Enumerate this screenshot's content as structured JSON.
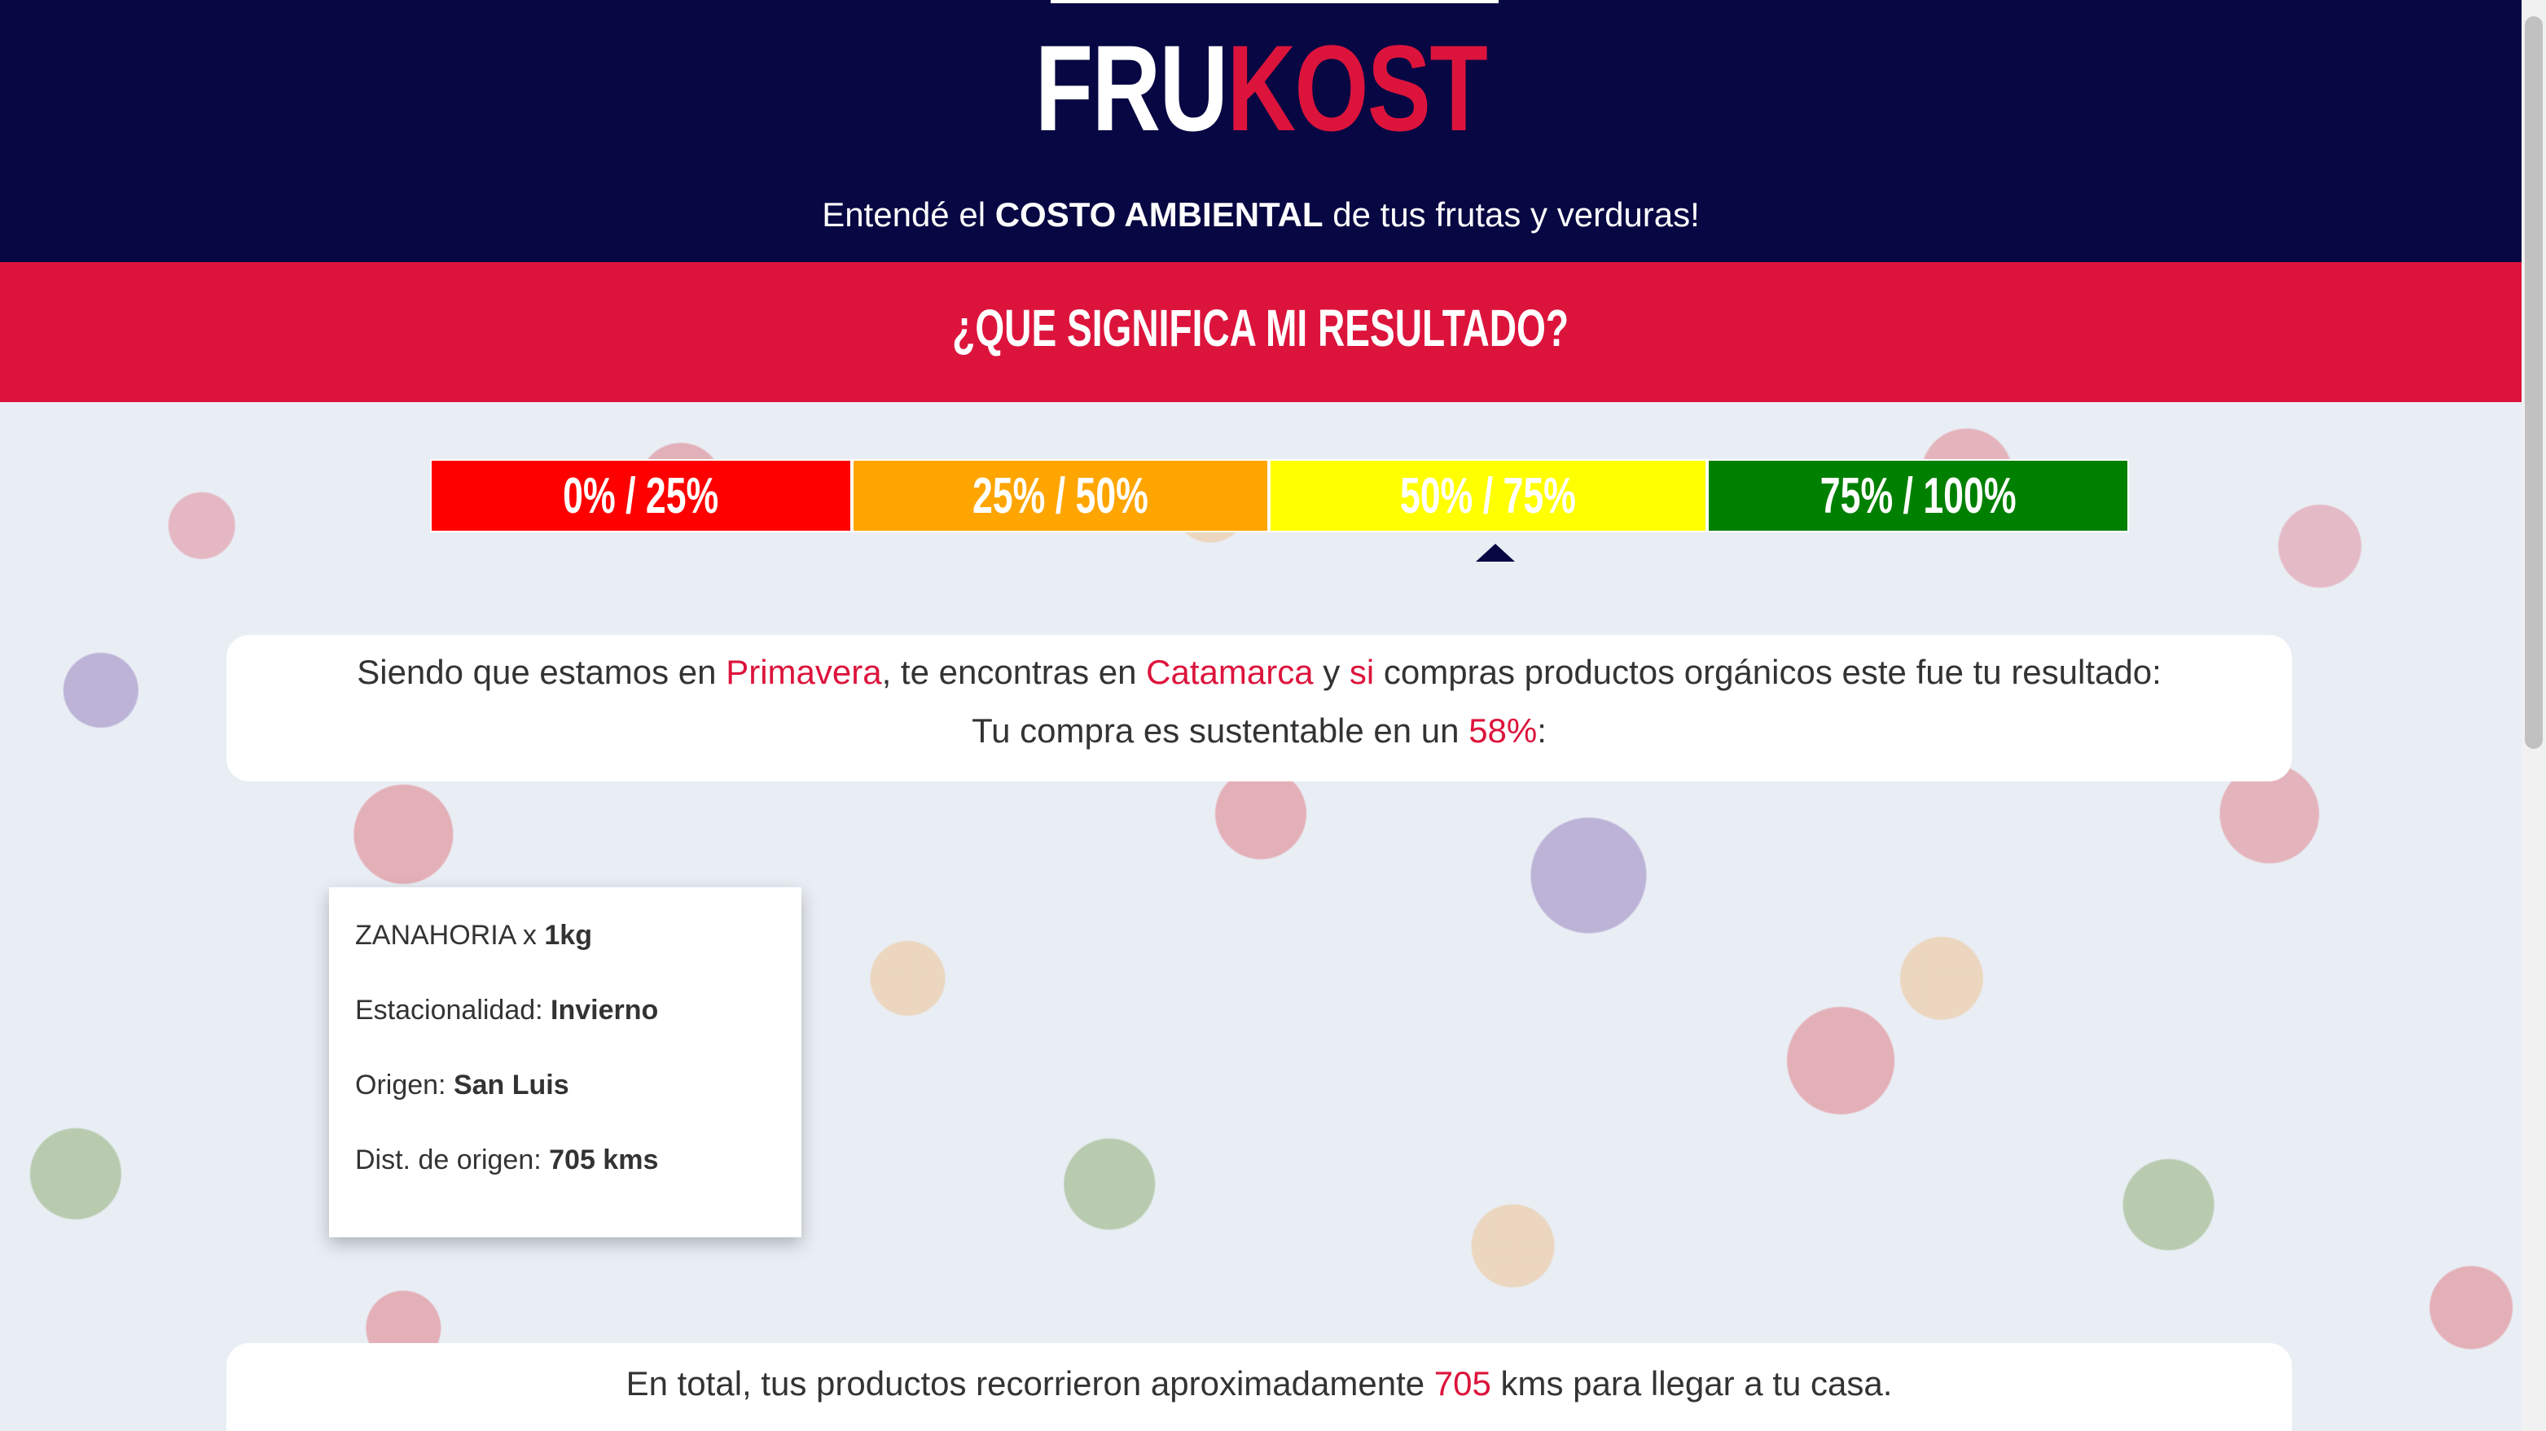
{
  "header": {
    "logo_part1": "FRU",
    "logo_part2": "KOST",
    "tagline_pre": "Entendé el ",
    "tagline_bold": "COSTO AMBIENTAL",
    "tagline_post": " de tus frutas y verduras!"
  },
  "banner": {
    "title": "¿QUE SIGNIFICA MI RESULTADO?"
  },
  "scale": {
    "segments": [
      {
        "label": "0% / 25%",
        "color": "#ff0000"
      },
      {
        "label": "25% / 50%",
        "color": "#ffa500"
      },
      {
        "label": "50% / 75%",
        "color": "#ffff00"
      },
      {
        "label": "75% / 100%",
        "color": "#008000"
      }
    ],
    "marker_value_percent": 58
  },
  "result": {
    "l1_a": "Siendo que estamos en ",
    "season": "Primavera",
    "l1_b": ", te encontras en ",
    "location": "Catamarca",
    "l1_c": " y ",
    "organic": "si",
    "l1_d": " compras productos orgánicos este fue tu resultado:",
    "l2_a": "Tu compra es sustentable en un ",
    "percent": "58%",
    "l2_b": ":"
  },
  "product_card": {
    "name_label": "ZANAHORIA x ",
    "name_qty": "1kg",
    "season_label": "Estacionalidad: ",
    "season_value": "Invierno",
    "origin_label": "Origen: ",
    "origin_value": "San Luis",
    "distance_label": "Dist. de origen: ",
    "distance_value": "705 kms"
  },
  "total": {
    "pre": "En total, tus productos recorrieron aproximadamente ",
    "kms": "705",
    "post": " kms para llegar a tu casa."
  },
  "colors": {
    "navy": "#070743",
    "crimson": "#dc143c"
  }
}
